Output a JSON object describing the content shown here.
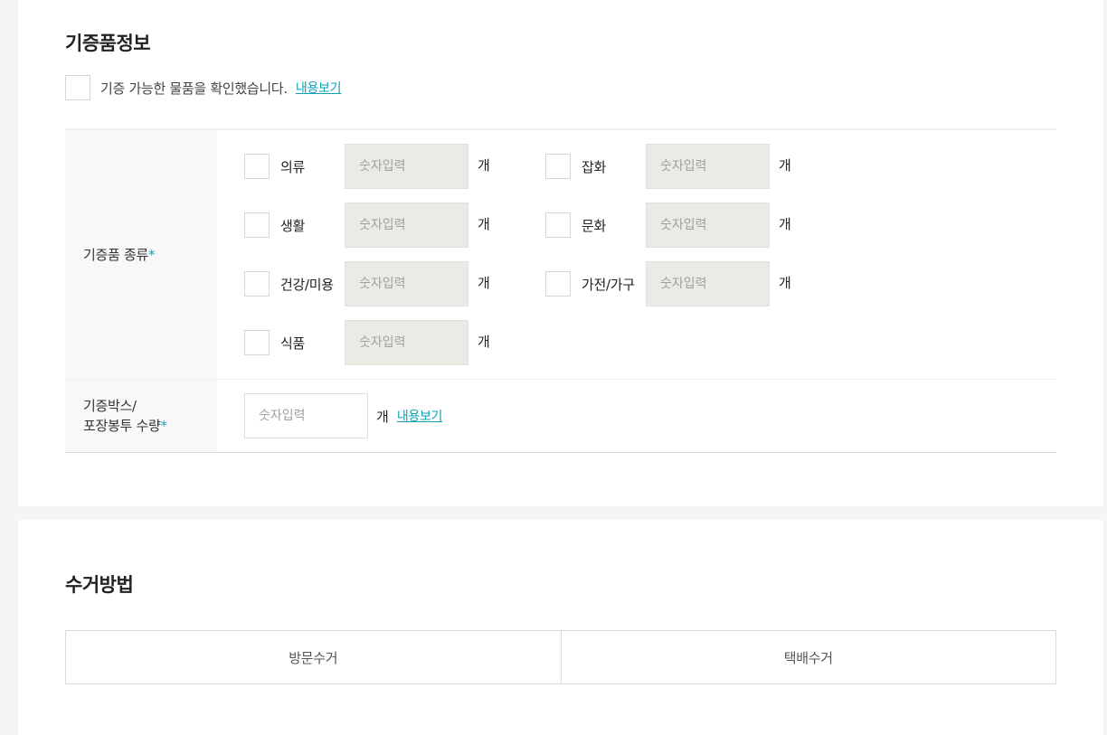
{
  "donation_info": {
    "title": "기증품정보",
    "agree_text": "기증 가능한 물품을 확인했습니다.",
    "agree_link": "내용보기",
    "types_label": "기증품 종류",
    "required_mark": "*",
    "unit": "개",
    "input_placeholder": "숫자입력",
    "items": [
      {
        "label": "의류",
        "quantity": ""
      },
      {
        "label": "잡화",
        "quantity": ""
      },
      {
        "label": "생활",
        "quantity": ""
      },
      {
        "label": "문화",
        "quantity": ""
      },
      {
        "label": "건강/미용",
        "quantity": ""
      },
      {
        "label": "가전/가구",
        "quantity": ""
      },
      {
        "label": "식품",
        "quantity": ""
      }
    ],
    "box_label_line1": "기증박스/",
    "box_label_line2": "포장봉투 수량",
    "box_quantity": "",
    "box_link": "내용보기"
  },
  "pickup": {
    "title": "수거방법",
    "options": [
      "방문수거",
      "택배수거"
    ]
  }
}
